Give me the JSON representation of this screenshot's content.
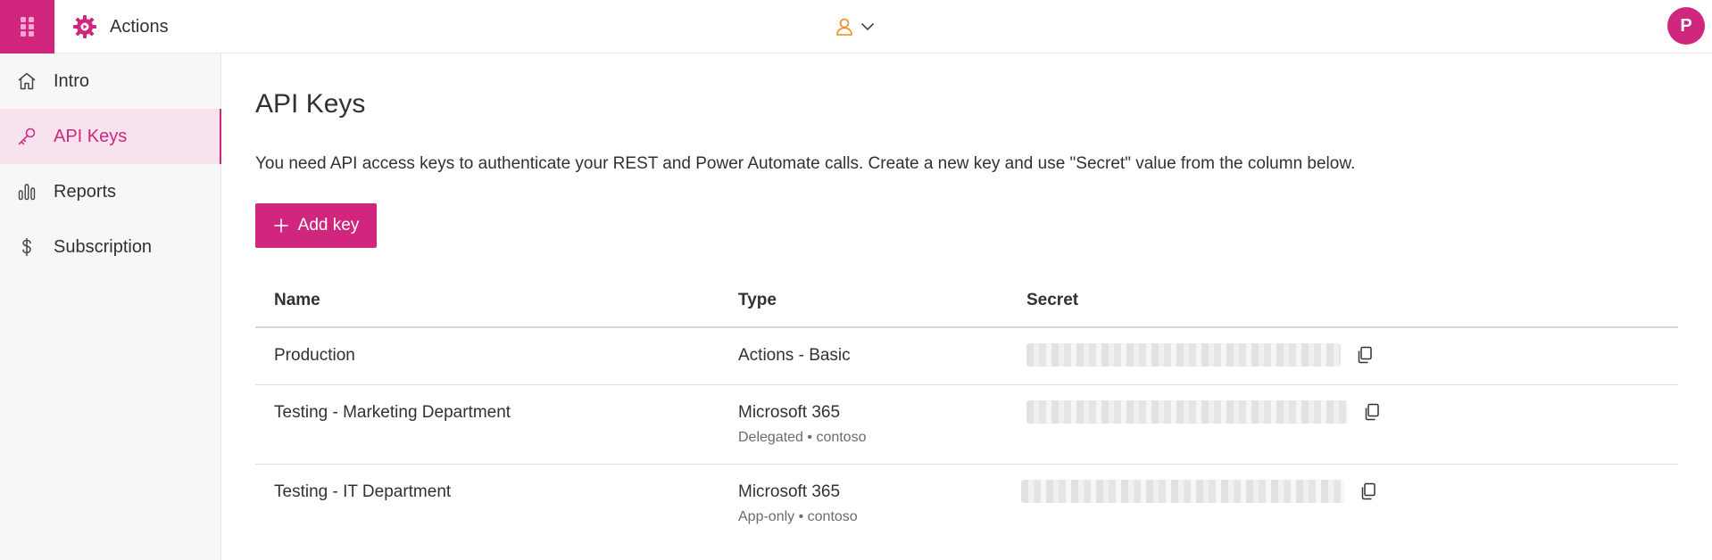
{
  "header": {
    "app_title": "Actions",
    "avatar_initial": "P",
    "brand_color": "#d0267e"
  },
  "sidebar": {
    "items": [
      {
        "label": "Intro",
        "icon": "home-icon",
        "active": false
      },
      {
        "label": "API Keys",
        "icon": "key-icon",
        "active": true
      },
      {
        "label": "Reports",
        "icon": "bar-chart-icon",
        "active": false
      },
      {
        "label": "Subscription",
        "icon": "dollar-icon",
        "active": false
      }
    ]
  },
  "main": {
    "title": "API Keys",
    "description": "You need API access keys to authenticate your REST and Power Automate calls. Create a new key and use \"Secret\" value from the column below.",
    "add_button_label": "Add key",
    "table": {
      "headers": {
        "name": "Name",
        "type": "Type",
        "secret": "Secret"
      },
      "rows": [
        {
          "name": "Production",
          "type": "Actions - Basic",
          "type_detail": ""
        },
        {
          "name": "Testing - Marketing Department",
          "type": "Microsoft 365",
          "type_detail": "Delegated • contoso"
        },
        {
          "name": "Testing - IT Department",
          "type": "Microsoft 365",
          "type_detail": "App-only • contoso"
        }
      ]
    }
  }
}
